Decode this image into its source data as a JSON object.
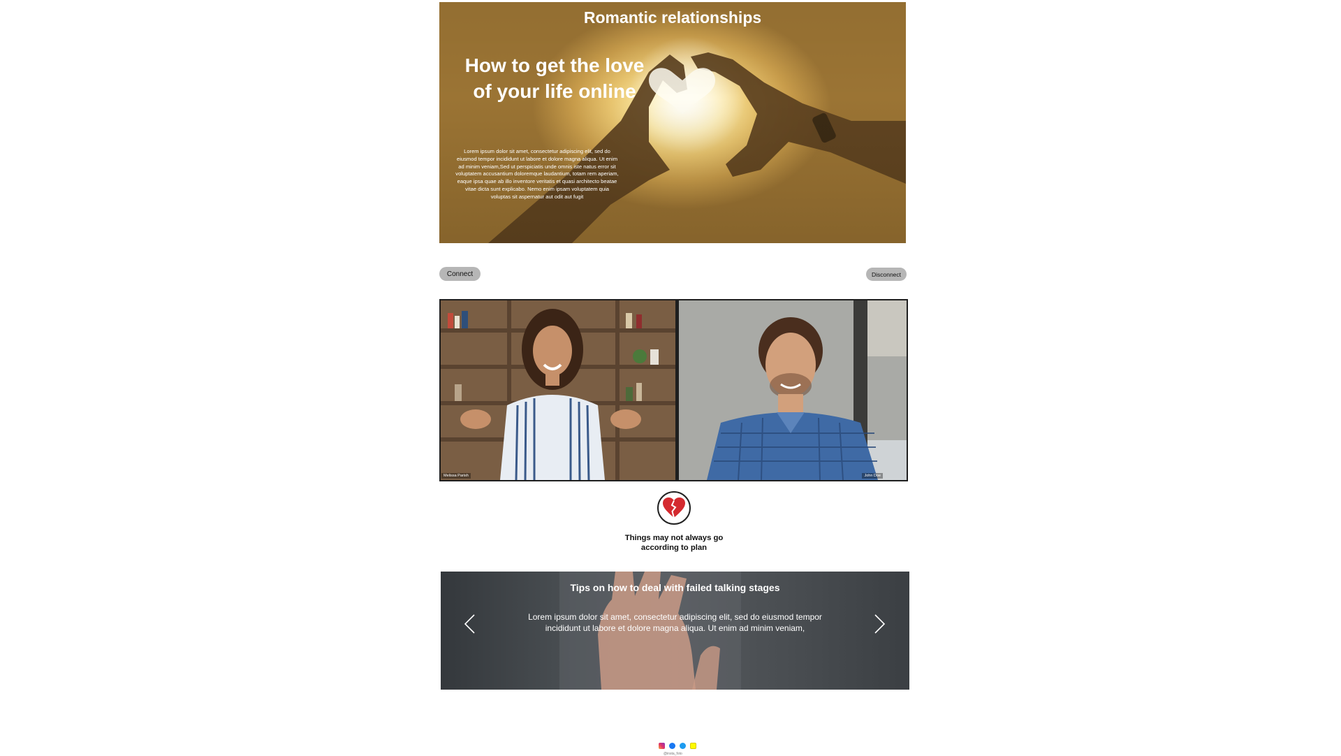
{
  "hero": {
    "title": "Romantic relationships",
    "heading": "How to get the love of your life online",
    "body": "Lorem ipsum dolor sit amet, consectetur adipiscing elit, sed do eiusmod tempor incididunt ut labore et dolore magna aliqua. Ut enim ad minim veniam,Sed ut perspiciatis unde omnis iste natus error sit voluptatem accusantium doloremque laudantium, totam rem aperiam, eaque ipsa quae ab illo inventore veritatis et quasi architecto beatae vitae dicta sunt explicabo. Nemo enim ipsam voluptatem quia voluptas sit aspernatur aut odit aut fugit"
  },
  "controls": {
    "connect_label": "Connect",
    "disconnect_label": "Disconnect"
  },
  "video_call": {
    "participants": [
      {
        "name": "Melissa Parish"
      },
      {
        "name": "John Doe"
      }
    ]
  },
  "notice": {
    "icon": "broken-heart-icon",
    "text": "Things may not always go according to plan"
  },
  "carousel": {
    "title": "Tips on how to deal with failed talking stages",
    "body": "Lorem ipsum dolor sit amet, consectetur adipiscing elit, sed do eiusmod tempor incididunt ut labore et dolore magna aliqua. Ut enim ad minim veniam,",
    "prev_icon": "chevron-left-icon",
    "next_icon": "chevron-right-icon"
  },
  "footer": {
    "social_icons": [
      "instagram-icon",
      "facebook-icon",
      "twitter-icon",
      "snapchat-icon"
    ],
    "copyright": "@insta_foto"
  },
  "colors": {
    "button_bg": "#b6b6b6",
    "heart_red": "#d42a2f",
    "slide_bg": "#4a4f53"
  }
}
